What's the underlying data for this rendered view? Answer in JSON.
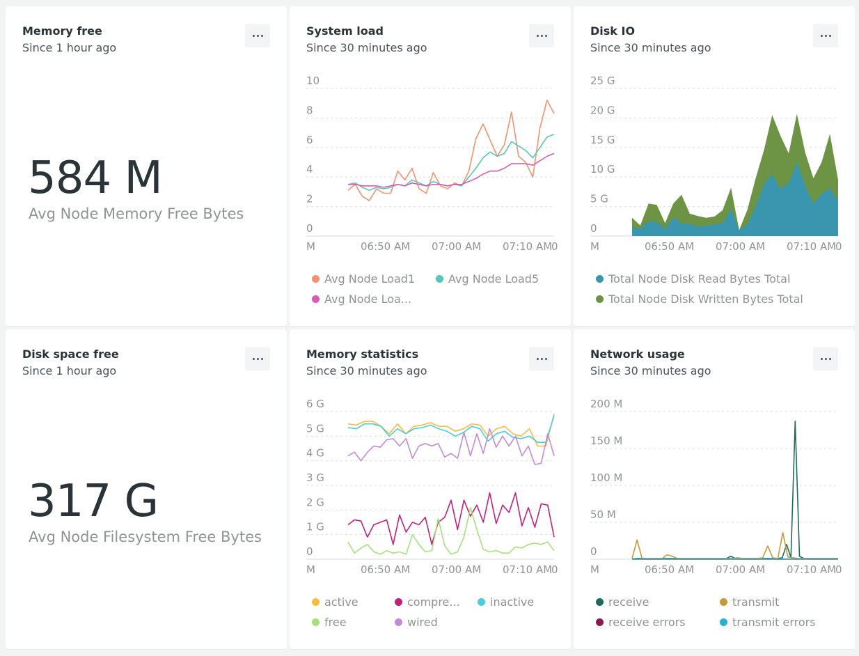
{
  "colors": {
    "load1": "#f4916f",
    "load5": "#56c8b5",
    "load15": "#d85cb3",
    "disk_read": "#3a96ae",
    "disk_written": "#6c9444",
    "active": "#f6bd42",
    "compressed": "#c2207f",
    "inactive": "#4dcbdb",
    "free": "#a6e07d",
    "wired": "#c28ad8",
    "receive": "#1f6b5a",
    "transmit": "#c59a36",
    "receive_errors": "#8b1a4e",
    "transmit_errors": "#2ab0d6"
  },
  "widgets": {
    "memory_free": {
      "title": "Memory free",
      "subtitle": "Since 1 hour ago",
      "value": "584 M",
      "label": "Avg Node Memory Free Bytes"
    },
    "disk_space": {
      "title": "Disk space free",
      "subtitle": "Since 1 hour ago",
      "value": "317 G",
      "label": "Avg Node Filesystem Free Bytes"
    },
    "system_load": {
      "title": "System load",
      "subtitle": "Since 30 minutes ago",
      "legend": [
        "Avg Node Load1",
        "Avg Node Load5",
        "Avg Node Loa..."
      ]
    },
    "disk_io": {
      "title": "Disk IO",
      "subtitle": "Since 30 minutes ago",
      "legend": [
        "Total Node Disk Read Bytes Total",
        "Total Node Disk Written Bytes Total"
      ]
    },
    "memory_stats": {
      "title": "Memory statistics",
      "subtitle": "Since 30 minutes ago",
      "legend": [
        "active",
        "compre...",
        "inactive",
        "free",
        "wired"
      ]
    },
    "network": {
      "title": "Network usage",
      "subtitle": "Since 30 minutes ago",
      "legend": [
        "receive",
        "transmit",
        "receive errors",
        "transmit errors"
      ]
    }
  },
  "icons": {
    "menu": "ellipsis-icon"
  },
  "chart_data": [
    {
      "id": "system_load",
      "type": "line",
      "yticks": [
        "10",
        "8",
        "6",
        "4",
        "2",
        "0"
      ],
      "xticks": [
        "M",
        "06:50 AM",
        "07:00 AM",
        "07:10 AM",
        "0"
      ],
      "ylim": [
        0,
        10
      ],
      "series": [
        {
          "name": "Avg Node Load1",
          "values": [
            3.1,
            3.5,
            2.7,
            2.4,
            3.2,
            2.9,
            2.9,
            4.4,
            3.8,
            4.6,
            3.2,
            2.9,
            4.3,
            3.4,
            3.2,
            3.6,
            3.4,
            4.4,
            6.6,
            7.6,
            6.5,
            5.4,
            6.2,
            8.4,
            5.4,
            5.0,
            4.0,
            7.3,
            9.2,
            8.3
          ]
        },
        {
          "name": "Avg Node Load5",
          "values": [
            3.5,
            3.6,
            3.3,
            3.1,
            3.3,
            3.2,
            3.3,
            3.5,
            3.4,
            3.8,
            3.6,
            3.4,
            3.7,
            3.5,
            3.4,
            3.5,
            3.4,
            4.0,
            4.6,
            5.3,
            5.7,
            5.4,
            5.6,
            6.4,
            6.1,
            5.8,
            5.3,
            6.0,
            6.7,
            6.9
          ]
        },
        {
          "name": "Avg Node Loa...",
          "values": [
            3.5,
            3.5,
            3.4,
            3.4,
            3.4,
            3.3,
            3.4,
            3.5,
            3.4,
            3.6,
            3.5,
            3.4,
            3.5,
            3.5,
            3.4,
            3.5,
            3.5,
            3.7,
            3.9,
            4.2,
            4.4,
            4.4,
            4.6,
            4.9,
            4.9,
            4.9,
            4.8,
            5.1,
            5.4,
            5.6
          ]
        }
      ]
    },
    {
      "id": "disk_io",
      "type": "area",
      "yticks": [
        "25 G",
        "20 G",
        "15 G",
        "10 G",
        "5 G",
        "0"
      ],
      "xticks": [
        "M",
        "06:50 AM",
        "07:00 AM",
        "07:10 AM",
        "0"
      ],
      "ylim": [
        0,
        25
      ],
      "series": [
        {
          "name": "Total Node Disk Read Bytes Total",
          "values": [
            1.5,
            1.2,
            2.5,
            2.4,
            1.2,
            3.2,
            2.2,
            2.1,
            1.6,
            1.8,
            2.0,
            2.2,
            4.6,
            1.0,
            2.0,
            5.1,
            8.8,
            10.5,
            8.0,
            9.0,
            12.5,
            8.6,
            5.5,
            7.2,
            8.1,
            6.0
          ]
        },
        {
          "name": "Total Node Disk Written Bytes Total",
          "values": [
            3.1,
            1.8,
            5.5,
            5.3,
            2.2,
            5.5,
            7.0,
            3.8,
            3.4,
            3.1,
            3.3,
            4.4,
            8.2,
            1.0,
            4.5,
            9.8,
            14.5,
            20.5,
            17.0,
            14.0,
            20.7,
            14.2,
            9.8,
            12.5,
            17.3,
            9.5
          ]
        }
      ]
    },
    {
      "id": "memory_stats",
      "type": "line",
      "yticks": [
        "6 G",
        "5 G",
        "4 G",
        "3 G",
        "2 G",
        "1 G",
        "0"
      ],
      "xticks": [
        "M",
        "06:50 AM",
        "07:00 AM",
        "07:10 AM",
        "0"
      ],
      "ylim": [
        0,
        6
      ],
      "series": [
        {
          "name": "active",
          "values": [
            5.5,
            5.45,
            5.6,
            5.6,
            5.4,
            5.1,
            5.5,
            5.1,
            5.4,
            5.45,
            5.55,
            5.4,
            5.4,
            5.2,
            5.3,
            5.5,
            5.45,
            5.0,
            5.3,
            5.4,
            5.1,
            5.0,
            5.3,
            4.6,
            4.6,
            5.9
          ]
        },
        {
          "name": "compre...",
          "values": [
            1.4,
            1.6,
            1.55,
            0.9,
            1.4,
            1.5,
            1.6,
            0.6,
            1.8,
            1.1,
            1.5,
            1.4,
            1.7,
            0.6,
            1.5,
            1.7,
            2.4,
            1.2,
            2.4,
            1.75,
            2.2,
            1.5,
            2.7,
            1.45,
            2.2,
            1.9,
            2.7,
            1.35,
            2.1,
            1.3,
            2.25,
            2.2,
            0.9
          ]
        },
        {
          "name": "inactive",
          "values": [
            5.35,
            5.3,
            5.5,
            5.5,
            5.4,
            5.0,
            5.3,
            5.1,
            5.3,
            5.35,
            5.45,
            5.3,
            5.2,
            5.0,
            5.15,
            5.4,
            5.3,
            4.8,
            5.1,
            5.2,
            4.95,
            4.9,
            5.0,
            4.75,
            4.75,
            5.85
          ]
        },
        {
          "name": "free",
          "values": [
            0.7,
            0.25,
            0.45,
            0.6,
            0.3,
            0.2,
            0.35,
            0.25,
            0.3,
            0.2,
            1.0,
            0.6,
            0.3,
            0.35,
            1.65,
            0.55,
            0.2,
            0.3,
            0.9,
            2.1,
            1.2,
            0.4,
            0.3,
            0.35,
            0.25,
            0.25,
            0.5,
            0.45,
            0.6,
            0.65,
            0.6,
            0.7,
            0.35
          ]
        },
        {
          "name": "wired",
          "values": [
            4.2,
            4.35,
            4.0,
            4.35,
            4.6,
            4.55,
            4.85,
            4.9,
            4.6,
            4.9,
            4.1,
            4.6,
            4.7,
            4.6,
            4.7,
            4.15,
            4.3,
            4.1,
            5.15,
            4.2,
            5.1,
            4.3,
            5.3,
            4.55,
            5.0,
            4.6,
            5.0,
            4.2,
            4.6,
            3.85,
            3.9,
            5.1,
            4.2
          ]
        }
      ]
    },
    {
      "id": "network",
      "type": "line",
      "yticks": [
        "200 M",
        "150 M",
        "100 M",
        "50 M",
        "0"
      ],
      "xticks": [
        "M",
        "06:50 AM",
        "07:00 AM",
        "07:10 AM",
        "0"
      ],
      "ylim": [
        0,
        200
      ],
      "series": [
        {
          "name": "receive",
          "values": [
            0.5,
            1,
            1,
            1,
            1,
            1,
            1,
            1,
            1,
            1,
            1,
            1,
            1,
            1,
            1,
            1,
            1,
            1,
            1,
            1,
            1,
            1,
            1,
            4,
            1,
            1,
            1,
            1,
            1,
            1,
            1,
            1,
            1,
            1,
            1,
            2,
            20,
            2,
            187,
            4,
            1,
            1,
            1,
            1,
            1,
            1,
            1,
            1,
            1
          ]
        },
        {
          "name": "transmit",
          "values": [
            1,
            26,
            1,
            1,
            1,
            1,
            1,
            6,
            4,
            1,
            1,
            1,
            1,
            1,
            1,
            1,
            1,
            1,
            1,
            1,
            1,
            2,
            1,
            1,
            1,
            1,
            2,
            18,
            2,
            1,
            36,
            3,
            2,
            1,
            1,
            1,
            1,
            1,
            1,
            1,
            1,
            1
          ]
        },
        {
          "name": "receive errors",
          "values": [
            0,
            0,
            0,
            0,
            0,
            0,
            0,
            0,
            0,
            0,
            0,
            0,
            0,
            0,
            0,
            0,
            0,
            0,
            0,
            0
          ]
        },
        {
          "name": "transmit errors",
          "values": [
            0.3,
            0.3,
            0.3,
            0.3,
            0.3,
            0.3,
            0.3,
            0.3,
            0.3,
            0.3,
            0.3,
            0.3,
            0.3,
            0.3,
            0.3,
            0.3,
            0.3,
            0.3,
            0.3,
            0.3
          ]
        }
      ]
    }
  ]
}
